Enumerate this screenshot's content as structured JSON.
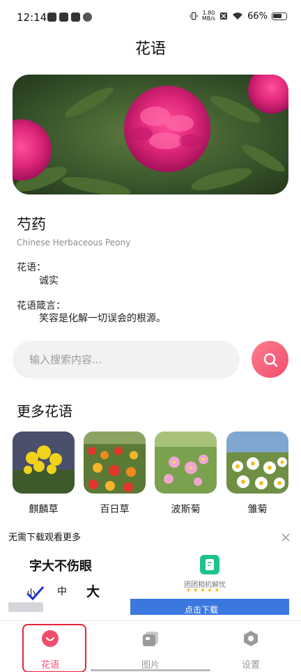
{
  "status_bar": {
    "time": "12:14",
    "net_speed_value": "1.80",
    "net_speed_unit": "MB/s",
    "battery": "66%"
  },
  "page": {
    "title": "花语"
  },
  "flower": {
    "name": "芍药",
    "english_name": "Chinese Herbaceous Peony",
    "meaning_label": "花语：",
    "meaning": "诚实",
    "motto_label": "花语箴言：",
    "motto": "笑容是化解一切误会的根源。"
  },
  "search": {
    "placeholder": "输入搜索内容...",
    "value": ""
  },
  "more": {
    "title": "更多花语",
    "items": [
      {
        "label": "麒麟草"
      },
      {
        "label": "百日草"
      },
      {
        "label": "波斯菊"
      },
      {
        "label": "雏菊"
      }
    ]
  },
  "ad": {
    "title": "无需下载观看更多",
    "headline": "字大不伤眼",
    "size_small": "小",
    "size_medium": "中",
    "size_large": "大",
    "app_name": "团团相机解忧",
    "stars": "★★★★★",
    "cta": "点击下载"
  },
  "nav": {
    "items": [
      {
        "label": "花语",
        "active": true
      },
      {
        "label": "图片",
        "active": false
      },
      {
        "label": "设置",
        "active": false
      }
    ]
  },
  "colors": {
    "accent": "#f04d6e",
    "nav_active": "#f04d6e",
    "nav_inactive": "#9a9a9a",
    "highlight_frame": "#e8243a"
  }
}
